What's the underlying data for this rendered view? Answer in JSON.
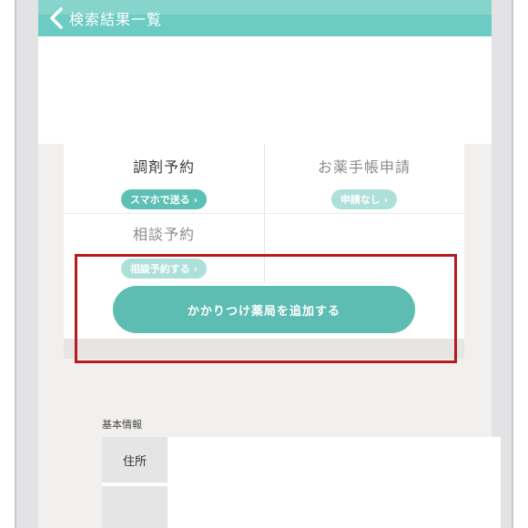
{
  "nav": {
    "title": "検索結果一覧"
  },
  "services": [
    {
      "title": "調剤予約",
      "button": "スマホで送る ›",
      "state": "active"
    },
    {
      "title": "お薬手帳申請",
      "button": "申請なし ›",
      "state": "inactive"
    },
    {
      "title": "相談予約",
      "button": "相談予約する ›",
      "state": "inactive"
    }
  ],
  "add_pharmacy_button": "かかりつけ薬局を追加する",
  "basic_info": {
    "heading": "基本情報",
    "rows": [
      {
        "label": "住所"
      }
    ]
  },
  "colors": {
    "accent": "#5dbdb2",
    "highlight": "#b71c1c"
  }
}
